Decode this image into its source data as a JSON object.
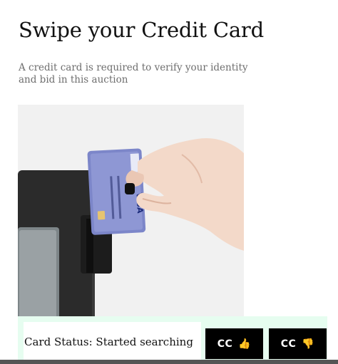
{
  "header": {
    "title": "Swipe your Credit Card",
    "subtitle": "A credit card is required to verify your identity and bid in this auction"
  },
  "illustration": {
    "icon": "hand-swiping-credit-card-image",
    "card_brand_text": "VISA"
  },
  "status": {
    "text": "Card Status: Started searching"
  },
  "actions": {
    "cc_up_label": "CC",
    "cc_up_icon": "👍",
    "cc_down_label": "CC",
    "cc_down_icon": "👎"
  },
  "colors": {
    "strip_bg": "#e6fdf0",
    "button_bg": "#000000",
    "button_text": "#ffffff"
  }
}
